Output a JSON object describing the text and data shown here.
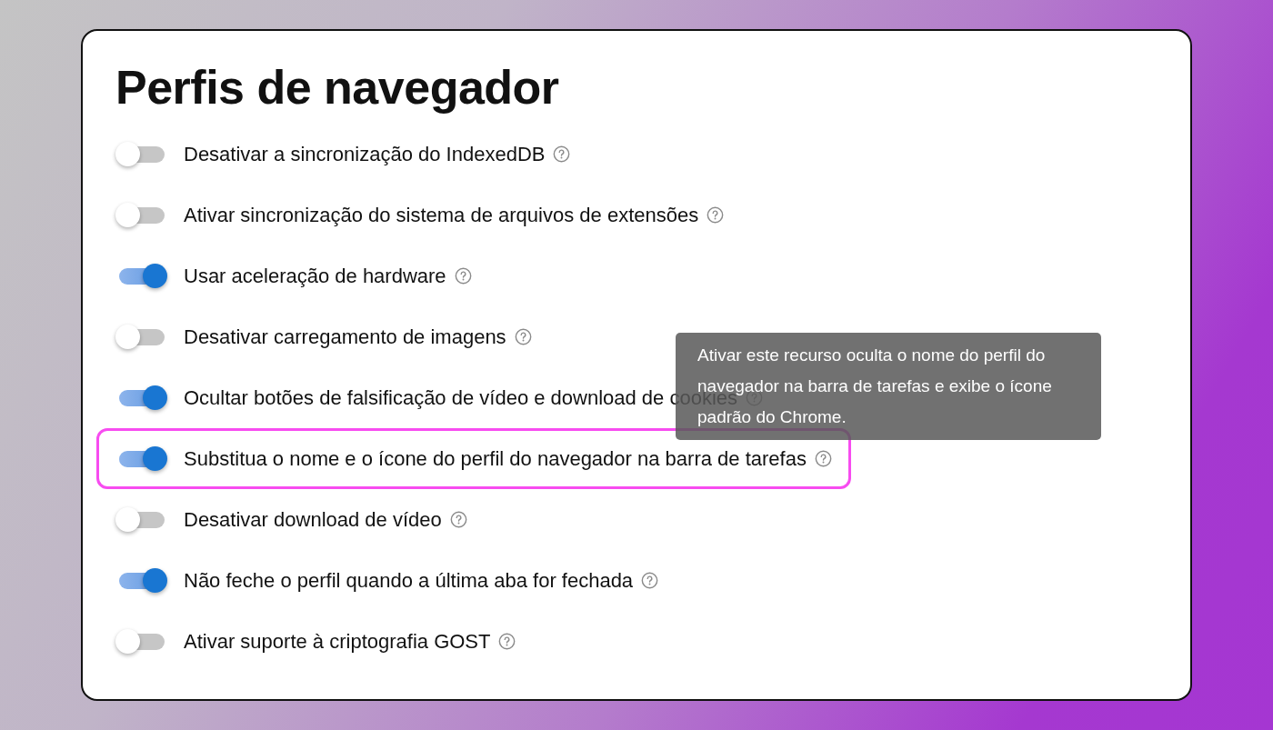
{
  "title": "Perfis de navegador",
  "settings": [
    {
      "label": "Desativar a sincronização do IndexedDB",
      "on": false,
      "highlighted": false
    },
    {
      "label": "Ativar sincronização do sistema de arquivos de extensões",
      "on": false,
      "highlighted": false
    },
    {
      "label": "Usar aceleração de hardware",
      "on": true,
      "highlighted": false
    },
    {
      "label": "Desativar carregamento de imagens",
      "on": false,
      "highlighted": false
    },
    {
      "label": "Ocultar botões de falsificação de vídeo e download de cookies",
      "on": true,
      "highlighted": false
    },
    {
      "label": "Substitua o nome e o ícone do perfil do navegador na barra de tarefas",
      "on": true,
      "highlighted": true
    },
    {
      "label": "Desativar download de vídeo",
      "on": false,
      "highlighted": false
    },
    {
      "label": "Não feche o perfil quando a última aba for fechada",
      "on": true,
      "highlighted": false
    },
    {
      "label": "Ativar suporte à criptografia GOST",
      "on": false,
      "highlighted": false
    }
  ],
  "tooltip": {
    "text": "Ativar este recurso oculta o nome do perfil do navegador na barra de tarefas e exibe o ícone padrão do Chrome."
  }
}
